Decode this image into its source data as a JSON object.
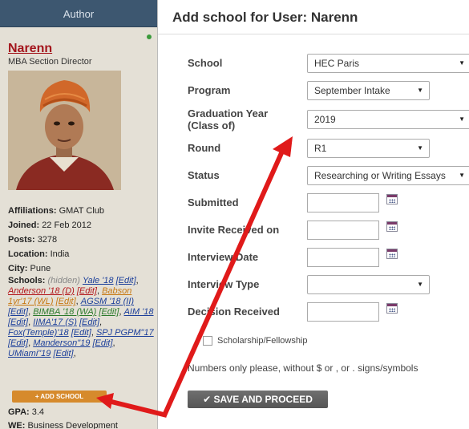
{
  "author_panel": {
    "header": "Author",
    "name": "Narenn",
    "title": "MBA Section Director",
    "affiliations_label": "Affiliations:",
    "affiliations_value": "GMAT Club",
    "joined_label": "Joined:",
    "joined_value": "22 Feb 2012",
    "posts_label": "Posts:",
    "posts_value": "3278",
    "location_label": "Location:",
    "location_value": "India",
    "city_label": "City:",
    "city_value": "Pune",
    "schools_label": "Schools:",
    "schools_hidden": "(hidden)",
    "schools": [
      {
        "text": "Yale '18",
        "style": "blue"
      },
      {
        "text": "[Edit]",
        "style": "blue"
      },
      {
        "text": "Anderson '18 (D)",
        "style": "red"
      },
      {
        "text": "[Edit]",
        "style": "red"
      },
      {
        "text": "Babson 1yr'17 (WL)",
        "style": "orange"
      },
      {
        "text": "[Edit]",
        "style": "orange"
      },
      {
        "text": "AGSM '18 (II)",
        "style": "blue"
      },
      {
        "text": "[Edit]",
        "style": "blue"
      },
      {
        "text": "BIMBA '18 (WA)",
        "style": "green"
      },
      {
        "text": "[Edit]",
        "style": "green"
      },
      {
        "text": "AIM '18",
        "style": "blue"
      },
      {
        "text": "[Edit]",
        "style": "blue"
      },
      {
        "text": "IIMA'17 (S)",
        "style": "blue"
      },
      {
        "text": "[Edit]",
        "style": "blue"
      },
      {
        "text": "Fox(Temple)'18",
        "style": "blue"
      },
      {
        "text": "[Edit]",
        "style": "blue"
      },
      {
        "text": "SPJ PGPM\"17",
        "style": "blue"
      },
      {
        "text": "[Edit]",
        "style": "blue"
      },
      {
        "text": "Manderson\"19",
        "style": "blue"
      },
      {
        "text": "[Edit]",
        "style": "blue"
      },
      {
        "text": "UMiami\"19",
        "style": "blue"
      },
      {
        "text": "[Edit]",
        "style": "blue"
      }
    ],
    "add_school_label": "+ ADD SCHOOL",
    "gpa_label": "GPA:",
    "gpa_value": "3.4",
    "we_label": "WE:",
    "we_value": "Business Development"
  },
  "modal": {
    "title": "Add school for User: Narenn",
    "fields": {
      "school": {
        "label": "School",
        "value": "HEC Paris"
      },
      "program": {
        "label": "Program",
        "value": "September Intake"
      },
      "grad_year": {
        "label": "Graduation Year\n(Class of)",
        "label_line1": "Graduation Year",
        "label_line2": "(Class of)",
        "value": "2019"
      },
      "round": {
        "label": "Round",
        "value": "R1"
      },
      "status": {
        "label": "Status",
        "value": "Researching or Writing Essays"
      },
      "submitted": {
        "label": "Submitted",
        "value": ""
      },
      "invite_received": {
        "label": "Invite Received on",
        "value": ""
      },
      "interview_date": {
        "label": "Interview Date",
        "value": ""
      },
      "interview_type": {
        "label": "Interview Type",
        "value": ""
      },
      "decision_received": {
        "label": "Decision Received",
        "value": ""
      }
    },
    "scholarship_label": "Scholarship/Fellowship",
    "note": "Numbers only please, without $ or , or . signs/symbols",
    "save_label": "✔ SAVE AND PROCEED"
  },
  "colors": {
    "header_bg": "#3d5770",
    "name_red": "#a3151c",
    "add_button": "#d68a2c",
    "save_button": "#5e5e5e",
    "annotation_arrow": "#e01a1a"
  },
  "icons": {
    "calendar": "calendar-icon",
    "dropdown": "chevron-down-icon",
    "check": "check-icon"
  }
}
